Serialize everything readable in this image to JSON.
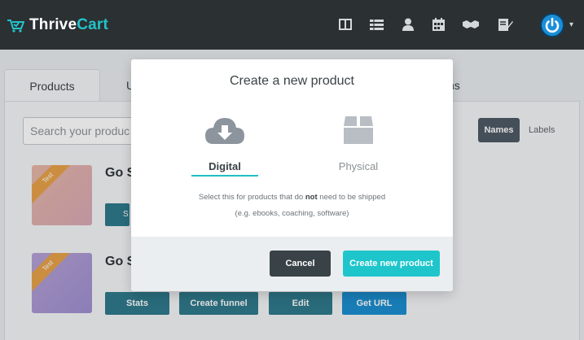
{
  "app": {
    "logo_part1": "Thrive",
    "logo_part2": "Cart",
    "brand_color": "#22c3c9"
  },
  "nav_icons": [
    "layout-icon",
    "list-icon",
    "user-icon",
    "calendar-icon",
    "handshake-icon",
    "edit-document-icon"
  ],
  "tabs": {
    "products": "Products",
    "tab2_partial": "U",
    "tab3_partial": "ns"
  },
  "search": {
    "placeholder": "Search your produc"
  },
  "view_toggle": {
    "names": "Names",
    "labels": "Labels"
  },
  "products": [
    {
      "title": "Go S",
      "badge": "Test"
    },
    {
      "title": "Go S",
      "badge": "Test"
    }
  ],
  "product_actions": {
    "stub": "S",
    "stats": "Stats",
    "create_funnel": "Create funnel",
    "edit": "Edit",
    "get_url": "Get URL"
  },
  "modal": {
    "title": "Create a new product",
    "options": [
      {
        "label": "Digital",
        "icon": "cloud-download-icon",
        "selected": true
      },
      {
        "label": "Physical",
        "icon": "box-icon",
        "selected": false
      }
    ],
    "description_prefix": "Select this for products that do ",
    "description_bold": "not",
    "description_suffix": " need to be shipped",
    "description_line2": "(e.g. ebooks, coaching, software)",
    "cancel": "Cancel",
    "create": "Create new product"
  }
}
